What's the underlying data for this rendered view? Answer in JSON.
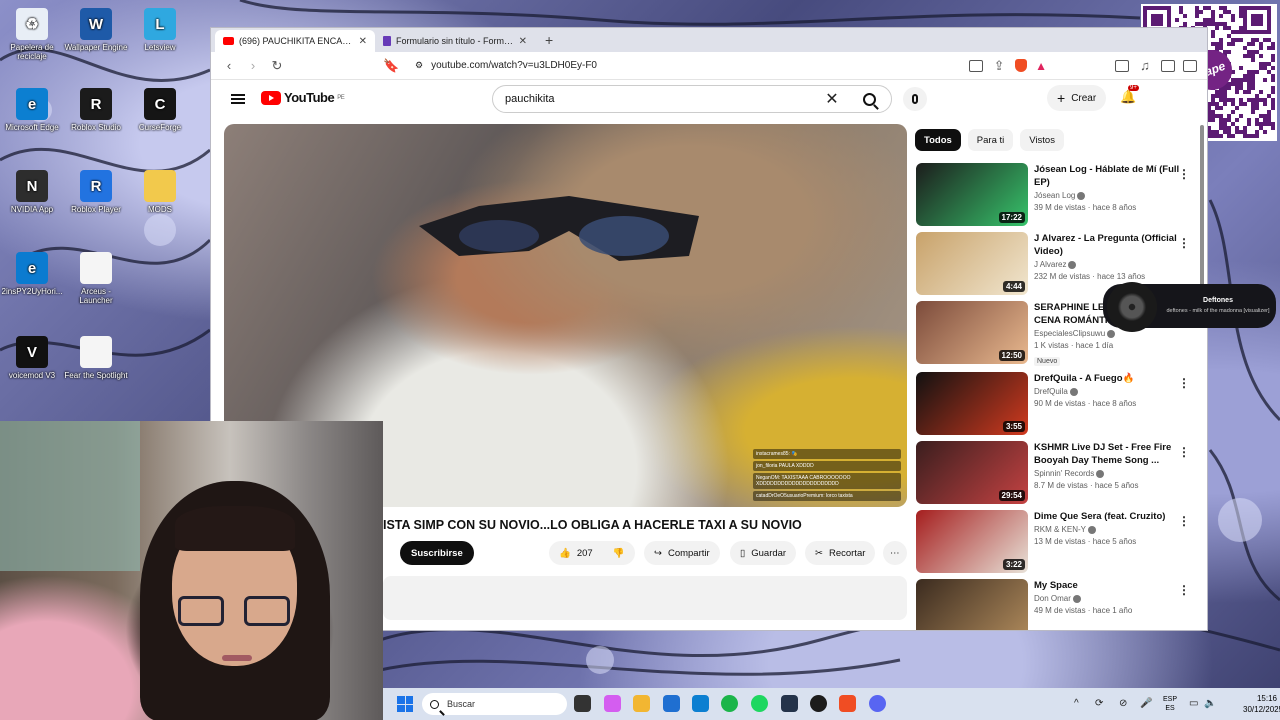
{
  "desktop": {
    "icons": [
      {
        "label": "Papelera de reciclaje",
        "glyph": "♻",
        "color": "#e8eef6"
      },
      {
        "label": "Wallpaper Engine",
        "glyph": "W",
        "color": "#1e5aa8"
      },
      {
        "label": "Letsview",
        "glyph": "L",
        "color": "#2fa8e0"
      },
      {
        "label": "Microsoft Edge",
        "glyph": "e",
        "color": "#0c7fd1"
      },
      {
        "label": "Roblox Studio",
        "glyph": "R",
        "color": "#1b1b1b"
      },
      {
        "label": "CurseForge",
        "glyph": "C",
        "color": "#151515"
      },
      {
        "label": "NVIDIA App",
        "glyph": "N",
        "color": "#2d2d2d"
      },
      {
        "label": "Roblox Player",
        "glyph": "R",
        "color": "#2273e0"
      },
      {
        "label": "MODS",
        "glyph": "",
        "color": "#f2c94c"
      },
      {
        "label": "2insPY2UyHori...",
        "glyph": "e",
        "color": "#0b7bd0"
      },
      {
        "label": "Arceus - Launcher",
        "glyph": "",
        "color": "#f5f5f5"
      },
      {
        "label": "voicemod V3",
        "glyph": "V",
        "color": "#111111"
      },
      {
        "label": "Fear the Spotlight",
        "glyph": "",
        "color": "#f5f5f5"
      }
    ]
  },
  "browser": {
    "tabs": [
      {
        "title": "(696) PAUCHIKITA ENCARA TA",
        "icon": "youtube-icon",
        "active": true
      },
      {
        "title": "Formulario sin título - Formularios de",
        "icon": "forms-icon",
        "active": false
      }
    ],
    "new_tab": "+",
    "url": "youtube.com/watch?v=u3LDH0Ey-F0"
  },
  "youtube": {
    "logo": "YouTube",
    "region": "PE",
    "search_query": "pauchikita",
    "create_label": "Crear",
    "notif_count": "9+",
    "video_title": "ISTA SIMP CON SU NOVIO...LO OBLIGA A HACERLE TAXI A SU NOVIO",
    "subscribe": "Suscribirse",
    "likes": "207",
    "share": "Compartir",
    "save": "Guardar",
    "clip": "Recortar",
    "chat_lines": [
      "instacrames85: 🎭",
      "jon_filoria PAULA XDDDD",
      "NeganOM: TAXISTAAA CABROOOOOOO XDDDDDDDDDDDDDDDDDDDDDD",
      "catadDrOeO5usuarioPremium: lorco taxista"
    ],
    "chips": [
      "Todos",
      "Para ti",
      "Vistos"
    ],
    "recommendations": [
      {
        "title": "Jósean Log - Háblate de Mí (Full EP)",
        "channel": "Jósean Log",
        "meta": "39 M de vistas · hace 8 años",
        "duration": "17:22",
        "colors": [
          "#1c1c1c",
          "#37c46b"
        ]
      },
      {
        "title": "J Alvarez - La Pregunta (Official Video)",
        "channel": "J Alvarez",
        "meta": "232 M de vistas · hace 13 años",
        "duration": "4:44",
        "colors": [
          "#c8a26a",
          "#f1e6cf"
        ]
      },
      {
        "title": "SERAPHINE LE PREPARA UNA CENA ROMÁNTICA",
        "channel": "EspecialesClipsuwu",
        "meta": "1 K vistas · hace 1 día",
        "duration": "12:50",
        "new": "Nuevo",
        "colors": [
          "#7c4b3b",
          "#e9b98f"
        ]
      },
      {
        "title": "DrefQuila - A Fuego🔥",
        "channel": "DrefQuila",
        "meta": "90 M de vistas · hace 8 años",
        "duration": "3:55",
        "colors": [
          "#111111",
          "#d13a1f"
        ]
      },
      {
        "title": "KSHMR Live DJ Set - Free Fire Booyah Day Theme Song ...",
        "channel": "Spinnin' Records",
        "meta": "8.7 M de vistas · hace 5 años",
        "duration": "29:54",
        "colors": [
          "#3a1e1e",
          "#c44242"
        ]
      },
      {
        "title": "Dime Que Sera (feat. Cruzito)",
        "channel": "RKM & KEN-Y",
        "meta": "13 M de vistas · hace 5 años",
        "duration": "3:22",
        "colors": [
          "#a51e1e",
          "#e8e2d8"
        ]
      },
      {
        "title": "My Space",
        "channel": "Don Omar",
        "meta": "49 M de vistas · hace 1 año",
        "duration": "",
        "colors": [
          "#3b2b1f",
          "#b08b5c"
        ]
      }
    ]
  },
  "now_playing": {
    "artist": "Deftones",
    "song": "deftones - milk of the madonna [visualizer]"
  },
  "qr": {
    "brand": "yape"
  },
  "taskbar": {
    "search_placeholder": "Buscar",
    "lang_top": "ESP",
    "lang_bottom": "ES",
    "time": "15:16",
    "date": "30/12/2025",
    "apps": [
      {
        "name": "task-view",
        "color": "#333333"
      },
      {
        "name": "copilot",
        "color": "#d45df0"
      },
      {
        "name": "file-explorer",
        "color": "#f2b632"
      },
      {
        "name": "store",
        "color": "#1f6fd1"
      },
      {
        "name": "edge",
        "color": "#0c7fd1"
      },
      {
        "name": "whatsapp",
        "color": "#1bb54a"
      },
      {
        "name": "spotify",
        "color": "#1ed760"
      },
      {
        "name": "steam",
        "color": "#24334a"
      },
      {
        "name": "xbox",
        "color": "#1c1c1c"
      },
      {
        "name": "brave",
        "color": "#f04d23"
      },
      {
        "name": "discord",
        "color": "#5865f2"
      }
    ]
  }
}
